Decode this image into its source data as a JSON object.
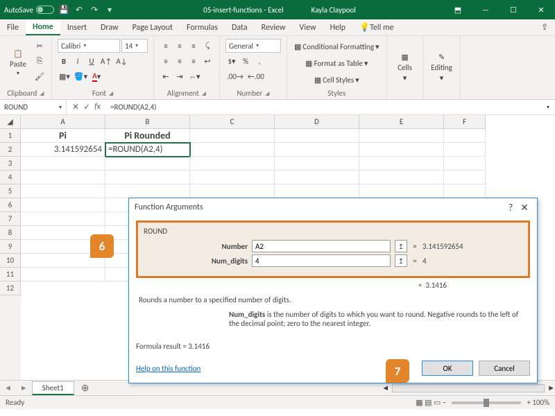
{
  "titlebar": {
    "autosave": "AutoSave",
    "filename": "05-insert-functions - Excel",
    "user": "Kayla Claypool"
  },
  "tabs": {
    "file": "File",
    "home": "Home",
    "insert": "Insert",
    "draw": "Draw",
    "pagelayout": "Page Layout",
    "formulas": "Formulas",
    "data": "Data",
    "review": "Review",
    "view": "View",
    "help": "Help",
    "tellme": "Tell me"
  },
  "ribbon": {
    "paste": "Paste",
    "clipboard": "Clipboard",
    "font": "Font",
    "fontname": "Calibri",
    "fontsize": "14",
    "alignment": "Alignment",
    "general": "General",
    "number": "Number",
    "condfmt": "Conditional Formatting",
    "fmttable": "Format as Table",
    "cellstyles": "Cell Styles",
    "styles": "Styles",
    "cells": "Cells",
    "editing": "Editing"
  },
  "formulabar": {
    "name": "ROUND",
    "formula": "=ROUND(A2,4)"
  },
  "columns": [
    "A",
    "B",
    "C",
    "D",
    "E",
    "F"
  ],
  "headers": {
    "a1": "Pi",
    "b1": "Pi Rounded"
  },
  "cells": {
    "a2": "3.141592654",
    "b2": "=ROUND(A2,4)"
  },
  "dialog": {
    "title": "Function Arguments",
    "fn": "ROUND",
    "arg1_label": "Number",
    "arg1_val": "A2",
    "arg1_res": "3.141592654",
    "arg2_label": "Num_digits",
    "arg2_val": "4",
    "arg2_res": "4",
    "preview": "3.1416",
    "desc1": "Rounds a number to a specified number of digits.",
    "desc2_b": "Num_digits",
    "desc2": " is the number of digits to which you want to round. Negative rounds to the left of the decimal point; zero to the nearest integer.",
    "formula_result_label": "Formula result = ",
    "formula_result": "3.1416",
    "help": "Help on this function",
    "ok": "OK",
    "cancel": "Cancel",
    "eq": "="
  },
  "callouts": {
    "c6": "6",
    "c7": "7"
  },
  "sheets": {
    "s1": "Sheet1"
  },
  "status": {
    "ready": "Ready",
    "zoom": "100%"
  }
}
